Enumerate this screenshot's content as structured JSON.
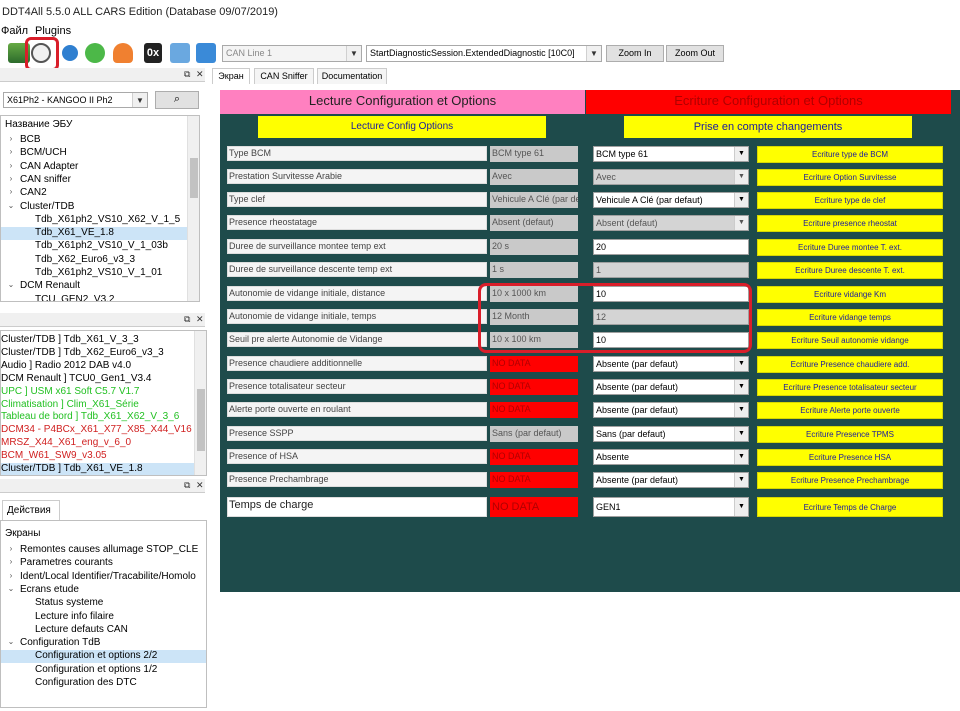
{
  "window": {
    "title": "DDT4All 5.5.0 ALL CARS Edition (Database 09/07/2019)"
  },
  "menu": [
    "Файл",
    "Plugins"
  ],
  "toolbar": {
    "can_line": "CAN Line 1",
    "session": "StartDiagnosticSession.ExtendedDiagnostic [10C0]",
    "zoom_in": "Zoom In",
    "zoom_out": "Zoom Out",
    "hex_label": "0x"
  },
  "ecu_selector": {
    "value": "X61Ph2 - KANGOO II Ph2"
  },
  "tree": {
    "header": "Название ЭБУ",
    "items": [
      {
        "label": "BCB",
        "level": 1,
        "expander": "›"
      },
      {
        "label": "BCM/UCH",
        "level": 1,
        "expander": "›"
      },
      {
        "label": "CAN Adapter",
        "level": 1,
        "expander": "›"
      },
      {
        "label": "CAN sniffer",
        "level": 1,
        "expander": "›"
      },
      {
        "label": "CAN2",
        "level": 1,
        "expander": "›"
      },
      {
        "label": "Cluster/TDB",
        "level": 1,
        "expander": "⌄"
      },
      {
        "label": "Tdb_X61ph2_VS10_X62_V_1_5",
        "level": 2,
        "expander": ""
      },
      {
        "label": "Tdb_X61_VE_1.8",
        "level": 2,
        "expander": "",
        "selected": true
      },
      {
        "label": "Tdb_X61ph2_VS10_V_1_03b",
        "level": 2,
        "expander": ""
      },
      {
        "label": "Tdb_X62_Euro6_v3_3",
        "level": 2,
        "expander": ""
      },
      {
        "label": "Tdb_X61ph2_VS10_V_1_01",
        "level": 2,
        "expander": ""
      },
      {
        "label": "DCM Renault",
        "level": 1,
        "expander": "⌄"
      },
      {
        "label": "TCU_GEN2_V3.2",
        "level": 2,
        "expander": ""
      }
    ]
  },
  "log": {
    "items": [
      {
        "text": "Cluster/TDB ] Tdb_X61_V_3_3",
        "color": "#000000"
      },
      {
        "text": "Cluster/TDB ] Tdb_X62_Euro6_v3_3",
        "color": "#000000"
      },
      {
        "text": "Audio ] Radio 2012 DAB v4.0",
        "color": "#000000"
      },
      {
        "text": "DCM Renault ] TCU0_Gen1_V3.4",
        "color": "#000000"
      },
      {
        "text": "UPC ] USM x61 Soft C5.7 V1.7",
        "color": "#22c022"
      },
      {
        "text": "Climatisation ] Clim_X61_Série",
        "color": "#22c022"
      },
      {
        "text": "Tableau de bord ] Tdb_X61_X62_V_3_6",
        "color": "#22c022"
      },
      {
        "text": "DCM34 - P4BCx_X61_X77_X85_X44_V16",
        "color": "#d02020"
      },
      {
        "text": "MRSZ_X44_X61_eng_v_6_0",
        "color": "#d02020"
      },
      {
        "text": "BCM_W61_SW9_v3.05",
        "color": "#d02020"
      },
      {
        "text": "Cluster/TDB ] Tdb_X61_VE_1.8",
        "color": "#000000",
        "selected": true
      }
    ]
  },
  "actions": {
    "tab": "Действия",
    "header": "Экраны",
    "items": [
      {
        "label": "Remontes causes allumage STOP_CLE",
        "level": 1,
        "expander": "›"
      },
      {
        "label": "Parametres courants",
        "level": 1,
        "expander": "›"
      },
      {
        "label": "Ident/Local Identifier/Tracabilite/Homolo",
        "level": 1,
        "expander": "›"
      },
      {
        "label": "Ecrans etude",
        "level": 1,
        "expander": "⌄"
      },
      {
        "label": "Status systeme",
        "level": 2,
        "expander": ""
      },
      {
        "label": "Lecture info filaire",
        "level": 2,
        "expander": ""
      },
      {
        "label": "Lecture defauts CAN",
        "level": 2,
        "expander": ""
      },
      {
        "label": "Configuration TdB",
        "level": 1,
        "expander": "⌄"
      },
      {
        "label": "Configuration et options 2/2",
        "level": 2,
        "expander": "",
        "selected": true
      },
      {
        "label": "Configuration et options 1/2",
        "level": 2,
        "expander": ""
      },
      {
        "label": "Configuration des DTC",
        "level": 2,
        "expander": ""
      }
    ]
  },
  "tabs": [
    "Экран",
    "CAN Sniffer",
    "Documentation"
  ],
  "screen": {
    "read_header": "Lecture Configuration et Options",
    "write_header": "Ecriture Configuration et Options",
    "read_button": "Lecture Config  Options",
    "apply_button": "Prise en compte changements",
    "rows": [
      {
        "label": "Type BCM",
        "value": "BCM type 61",
        "nodata": false,
        "input": "BCM type 61",
        "dropdown": true,
        "disabled": false,
        "write": "Ecriture type de BCM"
      },
      {
        "label": "Prestation Survitesse Arabie",
        "value": "Avec",
        "nodata": false,
        "input": "Avec",
        "dropdown": true,
        "disabled": true,
        "write": "Ecriture Option Survitesse"
      },
      {
        "label": "Type clef",
        "value": "Vehicule A Clé (par defa",
        "nodata": false,
        "input": "Vehicule A Clé (par defaut)",
        "dropdown": true,
        "disabled": false,
        "write": "Ecriture type de clef"
      },
      {
        "label": "Presence rheostatage",
        "value": "Absent (defaut)",
        "nodata": false,
        "input": "Absent (defaut)",
        "dropdown": true,
        "disabled": true,
        "write": "Ecriture presence rheostat"
      },
      {
        "label": "Duree de surveillance montee temp ext",
        "value": "20 s",
        "nodata": false,
        "input": "20",
        "dropdown": false,
        "disabled": false,
        "write": "Ecriture Duree montee T. ext."
      },
      {
        "label": "Duree de surveillance descente temp ext",
        "value": "1 s",
        "nodata": false,
        "input": "1",
        "dropdown": false,
        "disabled": true,
        "write": "Ecriture Duree descente T. ext."
      },
      {
        "label": "Autonomie de vidange initiale, distance",
        "value": "10 x 1000 km",
        "nodata": false,
        "input": "10",
        "dropdown": false,
        "disabled": false,
        "write": "Ecriture vidange Km"
      },
      {
        "label": "Autonomie de vidange initiale, temps",
        "value": "12 Month",
        "nodata": false,
        "input": "12",
        "dropdown": false,
        "disabled": true,
        "write": "Ecriture vidange temps"
      },
      {
        "label": "Seuil pre alerte Autonomie de Vidange",
        "value": "10 x 100 km",
        "nodata": false,
        "input": "10",
        "dropdown": false,
        "disabled": false,
        "write": "Ecriture Seuil autonomie vidange"
      },
      {
        "label": "Presence chaudiere additionnelle",
        "value": "NO DATA",
        "nodata": true,
        "input": "Absente (par defaut)",
        "dropdown": true,
        "disabled": false,
        "write": "Ecriture Presence chaudiere add."
      },
      {
        "label": "Presence totalisateur secteur",
        "value": "NO DATA",
        "nodata": true,
        "input": "Absente (par defaut)",
        "dropdown": true,
        "disabled": false,
        "write": "Ecriture Presence totalisateur secteur"
      },
      {
        "label": "Alerte porte ouverte en roulant",
        "value": "NO DATA",
        "nodata": true,
        "input": "Absente (par defaut)",
        "dropdown": true,
        "disabled": false,
        "write": "Ecriture Alerte porte ouverte"
      },
      {
        "label": "Presence SSPP",
        "value": "Sans (par defaut)",
        "nodata": false,
        "input": "Sans (par defaut)",
        "dropdown": true,
        "disabled": false,
        "write": "Ecriture Presence TPMS"
      },
      {
        "label": "Presence of HSA",
        "value": "NO DATA",
        "nodata": true,
        "input": "Absente",
        "dropdown": true,
        "disabled": false,
        "write": "Ecriture Presence HSA"
      },
      {
        "label": "Presence Prechambrage",
        "value": "NO DATA",
        "nodata": true,
        "input": "Absente (par defaut)",
        "dropdown": true,
        "disabled": false,
        "write": "Ecriture Presence Prechambrage"
      },
      {
        "label": "Temps de charge",
        "value": "NO DATA",
        "nodata": true,
        "input": "GEN1",
        "dropdown": true,
        "disabled": false,
        "write": "Ecriture Temps de Charge"
      }
    ]
  },
  "colors": {
    "canvas_bg": "#1e4b4b",
    "read_header_bg": "#ff80c0",
    "write_header_bg": "#ff0000",
    "button_yellow": "#ffff00",
    "no_data_red": "#ff0000",
    "highlight_red": "#d91e2a"
  }
}
